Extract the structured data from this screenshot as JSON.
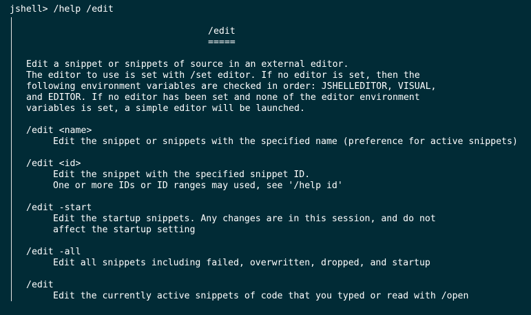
{
  "terminal": {
    "prompt": "jshell>",
    "command": "/help /edit"
  },
  "help": {
    "title": "/edit",
    "underline": "=====",
    "description": [
      "Edit a snippet or snippets of source in an external editor.",
      "The editor to use is set with /set editor. If no editor is set, then the",
      "following environment variables are checked in order: JSHELLEDITOR, VISUAL,",
      "and EDITOR. If no editor has been set and none of the editor environment",
      "variables is set, a simple editor will be launched."
    ],
    "options": [
      {
        "form": "/edit <name>",
        "lines": [
          "Edit the snippet or snippets with the specified name (preference for active snippets)"
        ]
      },
      {
        "form": "/edit <id>",
        "lines": [
          "Edit the snippet with the specified snippet ID.",
          "One or more IDs or ID ranges may used, see '/help id'"
        ]
      },
      {
        "form": "/edit -start",
        "lines": [
          "Edit the startup snippets. Any changes are in this session, and do not",
          "affect the startup setting"
        ]
      },
      {
        "form": "/edit -all",
        "lines": [
          "Edit all snippets including failed, overwritten, dropped, and startup"
        ]
      },
      {
        "form": "/edit",
        "lines": [
          "Edit the currently active snippets of code that you typed or read with /open"
        ]
      }
    ]
  }
}
